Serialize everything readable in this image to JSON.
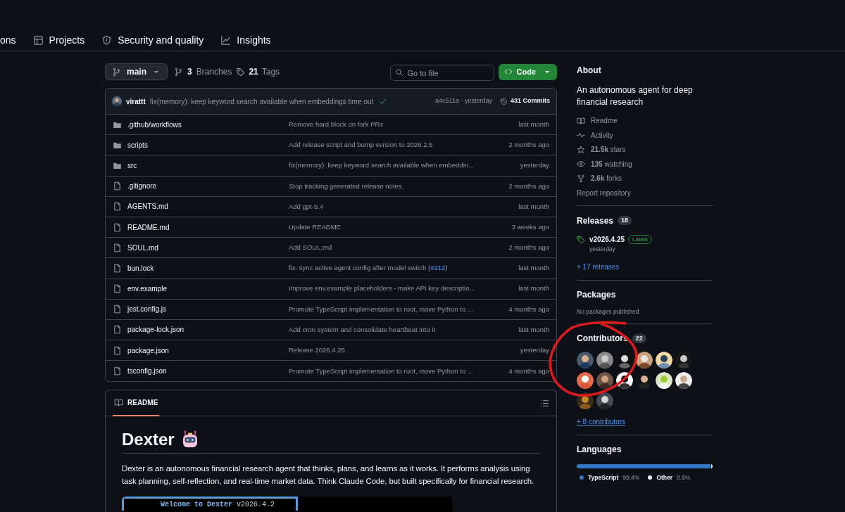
{
  "repo_nav": [
    {
      "kind": "cut",
      "label": "ons"
    },
    {
      "kind": "table",
      "label": "Projects"
    },
    {
      "kind": "shield",
      "label": "Security and quality"
    },
    {
      "kind": "graph",
      "label": "Insights"
    }
  ],
  "toolbar": {
    "branch": "main",
    "branches_count": "3",
    "branches_label": "Branches",
    "tags_count": "21",
    "tags_label": "Tags",
    "search_placeholder": "Go to file",
    "code_button": "Code"
  },
  "latest_commit": {
    "author": "virattt",
    "message": "fix(memory): keep keyword search available when embeddings time out",
    "hash_time": "a4c511a · yesterday",
    "commits": "431 Commits"
  },
  "files": [
    {
      "kind": "folder",
      "name": ".github/workflows",
      "message": "Remove hard block on fork PRs",
      "time": "last month"
    },
    {
      "kind": "folder",
      "name": "scripts",
      "message": "Add release script and bump version to 2026.2.5",
      "time": "2 months ago"
    },
    {
      "kind": "folder",
      "name": "src",
      "message": "fix(memory): keep keyword search available when embeddin...",
      "time": "yesterday"
    },
    {
      "kind": "file",
      "name": ".gitignore",
      "message": "Stop tracking generated release notes.",
      "time": "2 months ago"
    },
    {
      "kind": "file",
      "name": "AGENTS.md",
      "message": "Add gpt-5.4",
      "time": "last month"
    },
    {
      "kind": "file",
      "name": "README.md",
      "message": "Update README",
      "time": "3 weeks ago"
    },
    {
      "kind": "file",
      "name": "SOUL.md",
      "message": "Add SOUL.md",
      "time": "2 months ago"
    },
    {
      "kind": "file",
      "name": "bun.lock",
      "message": [
        {
          "kind": "text",
          "text": "fix: sync active agent config after model switch ("
        },
        {
          "kind": "link",
          "text": "#212"
        },
        {
          "kind": "text",
          "text": ")"
        }
      ],
      "time": "last month"
    },
    {
      "kind": "file",
      "name": "env.example",
      "message": "Improve env.example placeholders - make API key descriptio...",
      "time": "last month"
    },
    {
      "kind": "file",
      "name": "jest.config.js",
      "message": "Promote TypeScript implementation to root, move Python to ...",
      "time": "4 months ago"
    },
    {
      "kind": "file",
      "name": "package-lock.json",
      "message": "Add cron system and consolidate heartbeat into it",
      "time": "last month"
    },
    {
      "kind": "file",
      "name": "package.json",
      "message": "Release 2026.4.25.",
      "time": "yesterday"
    },
    {
      "kind": "file",
      "name": "tsconfig.json",
      "message": "Promote TypeScript implementation to root, move Python to ...",
      "time": "4 months ago"
    }
  ],
  "readme": {
    "tab": "README",
    "title": "Dexter",
    "description": "Dexter is an autonomous financial research agent that thinks, plans, and learns as it works. It performs analysis using task planning, self-reflection, and real-time market data. Think Claude Code, but built specifically for financial research.",
    "terminal": {
      "highlight": "Welcome to Dexter",
      "version": "v2026.4.2"
    }
  },
  "sidebar": {
    "about": {
      "heading": "About",
      "description": "An autonomous agent for deep financial research",
      "links": [
        {
          "kind": "book",
          "label": "Readme"
        },
        {
          "kind": "pulse",
          "label": "Activity"
        },
        {
          "kind": "star",
          "label": "**21.5k** stars"
        },
        {
          "kind": "eye",
          "label": "**135** watching"
        },
        {
          "kind": "fork",
          "label": "**2.6k** forks"
        }
      ],
      "report": "Report repository"
    },
    "releases": {
      "heading": "Releases",
      "count": "18",
      "latest": {
        "version": "v2026.4.25",
        "badge": "Latest",
        "time": "yesterday"
      },
      "more": "+ 17 releases"
    },
    "packages": {
      "heading": "Packages",
      "note": "No packages published"
    },
    "contributors": {
      "heading": "Contributors",
      "count": "22",
      "more": "+ 8 contributors"
    },
    "languages": {
      "heading": "Languages",
      "items": [
        {
          "name": "TypeScript",
          "percent": "99.4%",
          "color": "#3178c6"
        },
        {
          "name": "Other",
          "percent": "0.6%",
          "color": "#ededed"
        }
      ]
    }
  },
  "annotation": {
    "kind": "circle"
  }
}
